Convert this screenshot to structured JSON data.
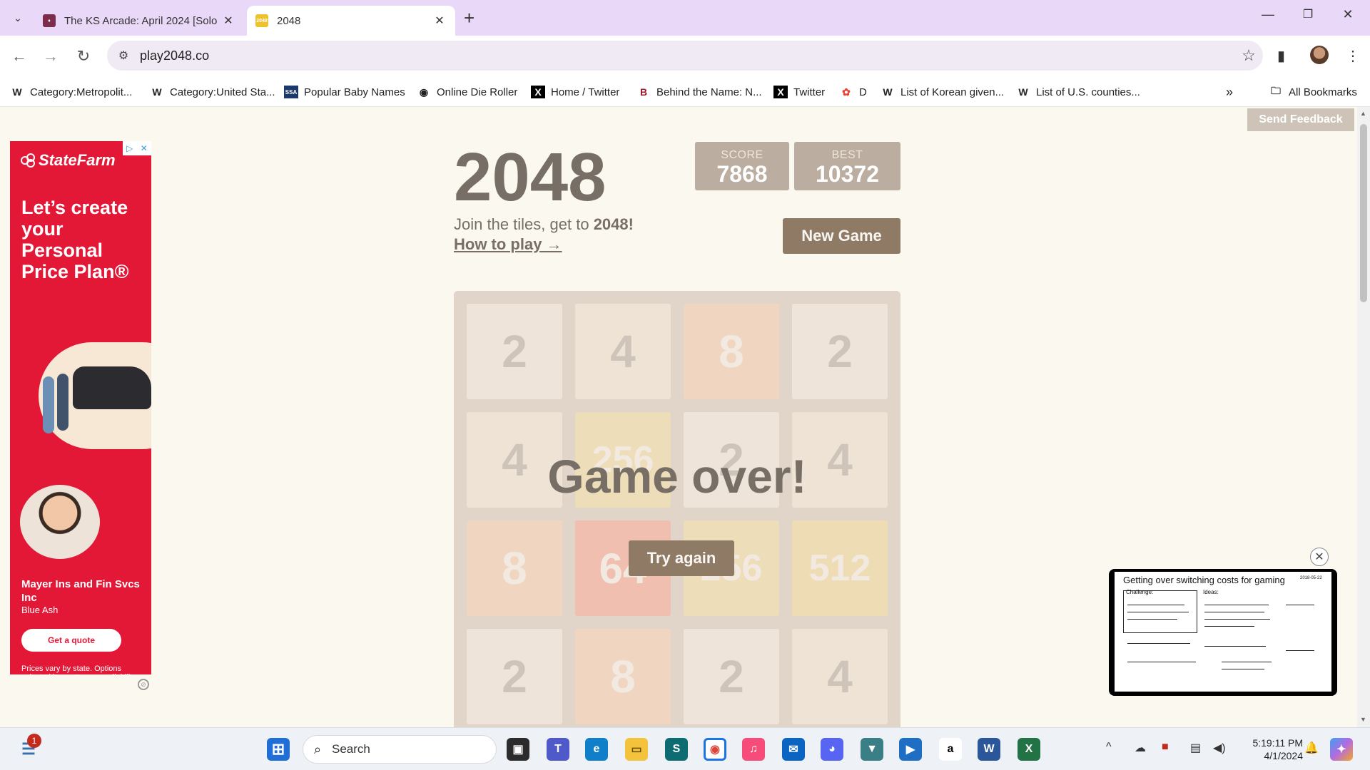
{
  "tabs": [
    {
      "title": "The KS Arcade: April 2024 [Solo",
      "active": false
    },
    {
      "title": "2048",
      "active": true
    }
  ],
  "toolbar": {
    "url": "play2048.co"
  },
  "bookmarks": [
    "Category:Metropolit...",
    "Category:United Sta...",
    "Popular Baby Names",
    "Online Die Roller",
    "Home / Twitter",
    "Behind the Name: N...",
    "Twitter",
    "D",
    "List of Korean given...",
    "List of U.S. counties..."
  ],
  "bookmarks_all": "All Bookmarks",
  "feedback": "Send Feedback",
  "ad": {
    "brand": "StateFarm",
    "headline": "Let’s create your Personal Price Plan®",
    "agent": "Mayer Ins and Fin Svcs Inc",
    "city": "Blue Ash",
    "cta": "Get a quote",
    "fine_print": "Prices vary by state. Options selected by customer; availability and eligibility may vary.",
    "brand_color": "#e31837"
  },
  "game": {
    "title": "2048",
    "score_label": "SCORE",
    "score": "7868",
    "best_label": "BEST",
    "best": "10372",
    "intro": "Join the tiles, get to",
    "intro_goal": "2048!",
    "how_to": "How to play →",
    "new_game": "New Game",
    "game_over": "Game over!",
    "try_again": "Try again",
    "grid": [
      [
        2,
        4,
        8,
        2
      ],
      [
        4,
        256,
        2,
        4
      ],
      [
        8,
        64,
        256,
        512
      ],
      [
        2,
        8,
        2,
        4
      ]
    ]
  },
  "popup": {
    "title": "Getting over switching costs for gaming",
    "date": "2018-05-22",
    "challenge_label": "Challenge:",
    "ideas_label": "Ideas:"
  },
  "taskbar": {
    "search_placeholder": "Search",
    "time": "5:19:11 PM",
    "date": "4/1/2024",
    "notifications": "1"
  }
}
